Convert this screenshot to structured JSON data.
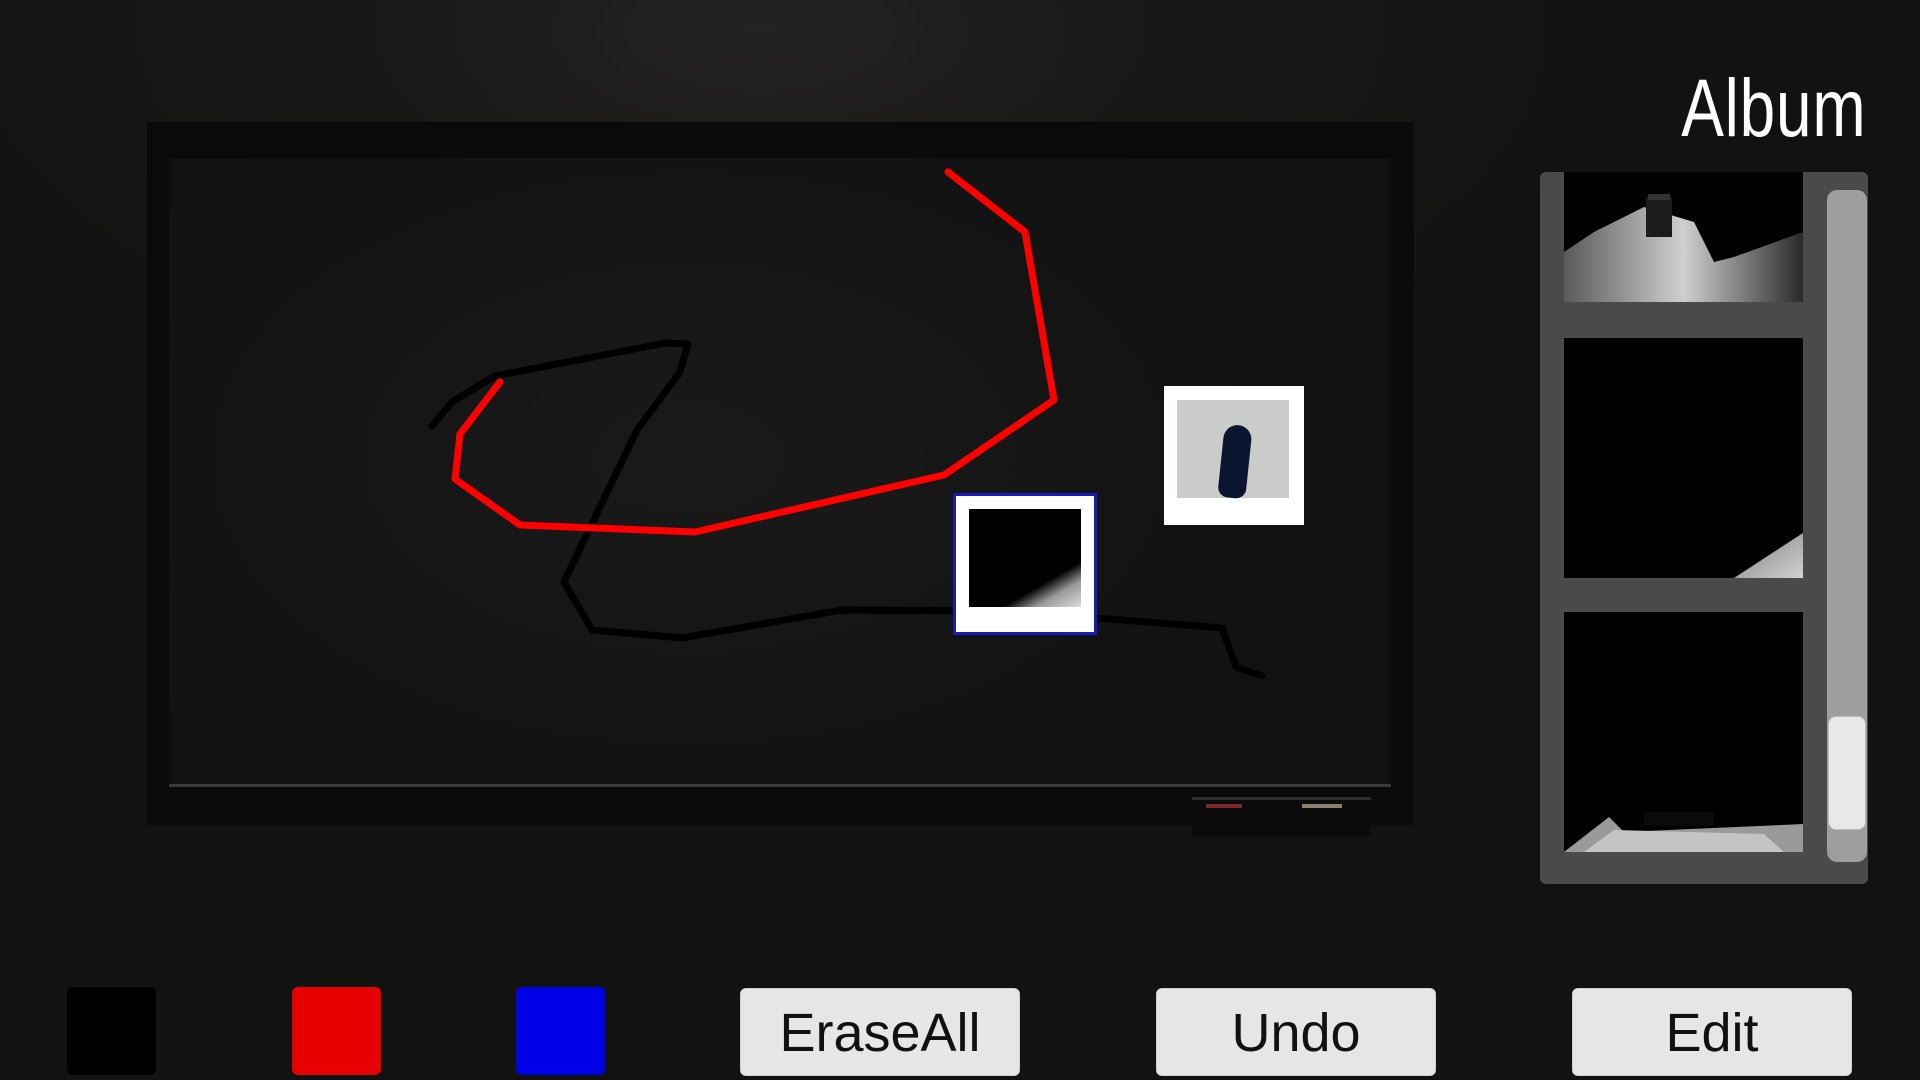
{
  "album": {
    "title": "Album",
    "thumbnails": [
      {
        "name": "album-thumb-1"
      },
      {
        "name": "album-thumb-2"
      },
      {
        "name": "album-thumb-3"
      }
    ],
    "scroll_position": 0.95,
    "scroll_visible_fraction": 0.17
  },
  "palette": {
    "colors": [
      {
        "name": "black",
        "hex": "#000000"
      },
      {
        "name": "red",
        "hex": "#e60000"
      },
      {
        "name": "blue",
        "hex": "#0000e6"
      }
    ]
  },
  "buttons": {
    "erase_all": "EraseAll",
    "undo": "Undo",
    "edit": "Edit"
  },
  "colors": {
    "stroke_red": "#ff0000",
    "stroke_black": "#000000",
    "photo_border_selected": "#1a1ab8"
  }
}
